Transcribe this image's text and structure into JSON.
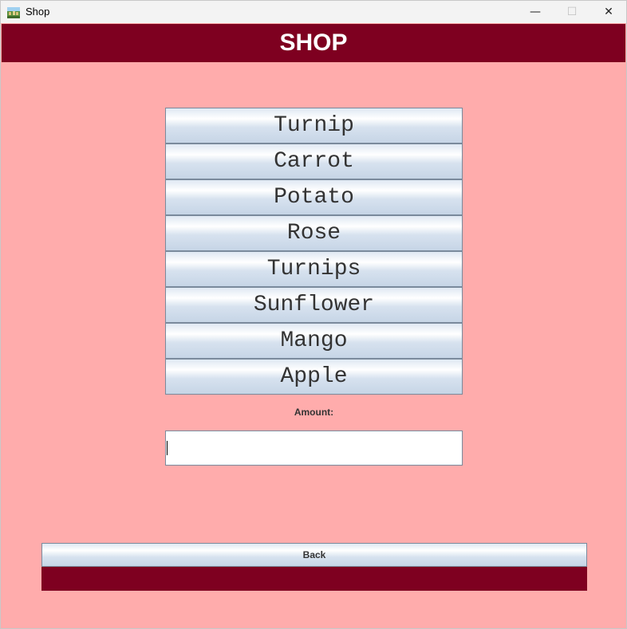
{
  "window": {
    "title": "Shop",
    "minimize_glyph": "—",
    "maximize_glyph": "☐",
    "close_glyph": "✕"
  },
  "header": {
    "title": "SHOP"
  },
  "items": [
    {
      "label": "Turnip"
    },
    {
      "label": "Carrot"
    },
    {
      "label": "Potato"
    },
    {
      "label": "Rose"
    },
    {
      "label": "Turnips"
    },
    {
      "label": "Sunflower"
    },
    {
      "label": "Mango"
    },
    {
      "label": "Apple"
    }
  ],
  "amount": {
    "label": "Amount:",
    "value": ""
  },
  "back_button": {
    "label": "Back"
  },
  "colors": {
    "header": "#7e0020",
    "background": "#ffacac",
    "footer": "#7e0020"
  }
}
